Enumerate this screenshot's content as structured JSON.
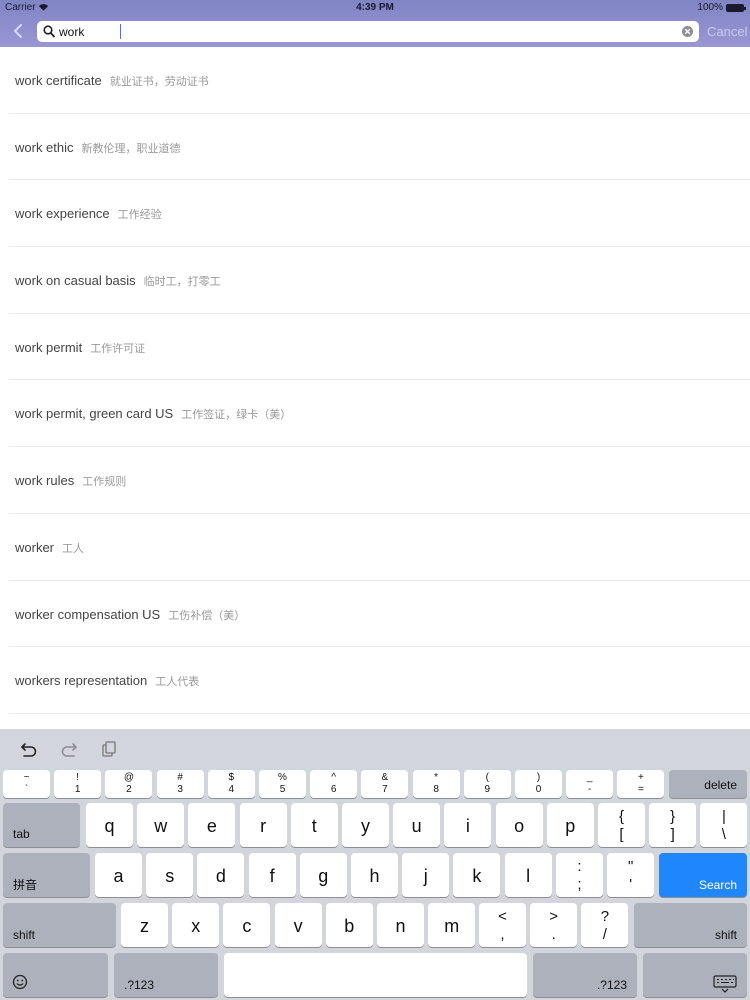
{
  "status_bar": {
    "carrier": "Carrier",
    "time": "4:39 PM",
    "battery": "100%"
  },
  "search": {
    "value": "work",
    "cancel_label": "Cancel"
  },
  "results": [
    {
      "term": "work certificate",
      "definition": "就业证书，劳动证书"
    },
    {
      "term": "work ethic",
      "definition": "新教伦理，职业道德"
    },
    {
      "term": "work experience",
      "definition": "工作经验"
    },
    {
      "term": "work on casual basis",
      "definition": "临时工，打零工"
    },
    {
      "term": "work permit",
      "definition": "工作许可证"
    },
    {
      "term": "work permit, green card US",
      "definition": "工作签证，绿卡（美）"
    },
    {
      "term": "work rules",
      "definition": "工作规则"
    },
    {
      "term": "worker",
      "definition": "工人"
    },
    {
      "term": "worker compensation US",
      "definition": "工伤补偿（美）"
    },
    {
      "term": "workers representation",
      "definition": "工人代表"
    }
  ],
  "keyboard": {
    "number_row": [
      {
        "top": "~",
        "bottom": "`"
      },
      {
        "top": "!",
        "bottom": "1"
      },
      {
        "top": "@",
        "bottom": "2"
      },
      {
        "top": "#",
        "bottom": "3"
      },
      {
        "top": "$",
        "bottom": "4"
      },
      {
        "top": "%",
        "bottom": "5"
      },
      {
        "top": "^",
        "bottom": "6"
      },
      {
        "top": "&",
        "bottom": "7"
      },
      {
        "top": "*",
        "bottom": "8"
      },
      {
        "top": "(",
        "bottom": "9"
      },
      {
        "top": ")",
        "bottom": "0"
      },
      {
        "top": "_",
        "bottom": "-"
      },
      {
        "top": "+",
        "bottom": "="
      }
    ],
    "delete_label": "delete",
    "tab_label": "tab",
    "row1": [
      "q",
      "w",
      "e",
      "r",
      "t",
      "y",
      "u",
      "i",
      "o",
      "p"
    ],
    "row1_symbols": [
      {
        "top": "{",
        "bottom": "["
      },
      {
        "top": "}",
        "bottom": "]"
      },
      {
        "top": "|",
        "bottom": "\\"
      }
    ],
    "pinyin_label": "拼音",
    "row2": [
      "a",
      "s",
      "d",
      "f",
      "g",
      "h",
      "j",
      "k",
      "l"
    ],
    "row2_symbols": [
      {
        "top": ":",
        "bottom": ";"
      },
      {
        "top": "\"",
        "bottom": "'"
      }
    ],
    "search_label": "Search",
    "shift_label": "shift",
    "row3": [
      "z",
      "x",
      "c",
      "v",
      "b",
      "n",
      "m"
    ],
    "row3_symbols": [
      {
        "top": "<",
        "bottom": ","
      },
      {
        "top": ">",
        "bottom": "."
      },
      {
        "top": "?",
        "bottom": "/"
      }
    ],
    "numbers_label": ".?123"
  },
  "colors": {
    "header": "#8f8fce",
    "search_key": "#1f87fb",
    "keyboard_bg": "#d3d5dc"
  }
}
